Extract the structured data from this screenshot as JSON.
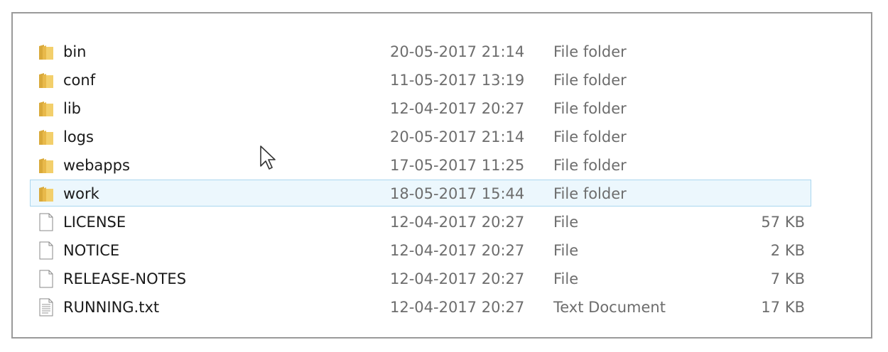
{
  "files": [
    {
      "name": "bin",
      "date": "20-05-2017 21:14",
      "type": "File folder",
      "size": "",
      "icon": "folder-icon"
    },
    {
      "name": "conf",
      "date": "11-05-2017 13:19",
      "type": "File folder",
      "size": "",
      "icon": "folder-icon"
    },
    {
      "name": "lib",
      "date": "12-04-2017 20:27",
      "type": "File folder",
      "size": "",
      "icon": "folder-icon"
    },
    {
      "name": "logs",
      "date": "20-05-2017 21:14",
      "type": "File folder",
      "size": "",
      "icon": "folder-icon"
    },
    {
      "name": "webapps",
      "date": "17-05-2017 11:25",
      "type": "File folder",
      "size": "",
      "icon": "folder-icon"
    },
    {
      "name": "work",
      "date": "18-05-2017 15:44",
      "type": "File folder",
      "size": "",
      "icon": "folder-icon",
      "selected": true
    },
    {
      "name": "LICENSE",
      "date": "12-04-2017 20:27",
      "type": "File",
      "size": "57 KB",
      "icon": "file-icon"
    },
    {
      "name": "NOTICE",
      "date": "12-04-2017 20:27",
      "type": "File",
      "size": "2 KB",
      "icon": "file-icon"
    },
    {
      "name": "RELEASE-NOTES",
      "date": "12-04-2017 20:27",
      "type": "File",
      "size": "7 KB",
      "icon": "file-icon"
    },
    {
      "name": "RUNNING.txt",
      "date": "12-04-2017 20:27",
      "type": "Text Document",
      "size": "17 KB",
      "icon": "text-document-icon"
    }
  ],
  "colors": {
    "selection_background": "#ecf7fd",
    "selection_border": "#a9d6ef",
    "folder": "#e8c35a"
  }
}
